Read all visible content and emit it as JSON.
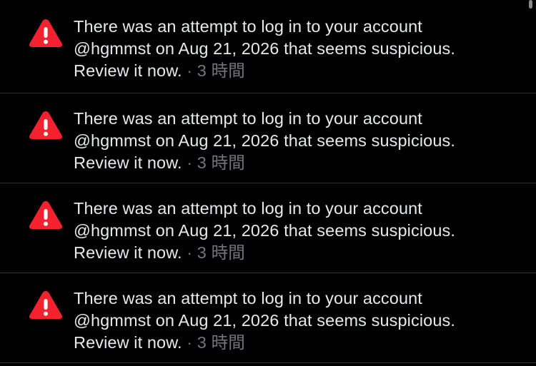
{
  "colors": {
    "background": "#000000",
    "text": "#e7e9ea",
    "secondary_text": "#71767b",
    "divider": "#2f3336",
    "alert_red": "#f4212e"
  },
  "notifications": [
    {
      "icon": "warning-icon",
      "line1": "There was an attempt to log in to your account",
      "line2": "@hgmmst on Aug 21, 2026 that seems suspicious.",
      "line3": "Review it now.",
      "separator": " · ",
      "time": "3 時間"
    },
    {
      "icon": "warning-icon",
      "line1": "There was an attempt to log in to your account",
      "line2": "@hgmmst on Aug 21, 2026 that seems suspicious.",
      "line3": "Review it now.",
      "separator": " · ",
      "time": "3 時間"
    },
    {
      "icon": "warning-icon",
      "line1": "There was an attempt to log in to your account",
      "line2": "@hgmmst on Aug 21, 2026 that seems suspicious.",
      "line3": "Review it now.",
      "separator": " · ",
      "time": "3 時間"
    },
    {
      "icon": "warning-icon",
      "line1": "There was an attempt to log in to your account",
      "line2": "@hgmmst on Aug 21, 2026 that seems suspicious.",
      "line3": "Review it now.",
      "separator": " · ",
      "time": "3 時間"
    }
  ]
}
